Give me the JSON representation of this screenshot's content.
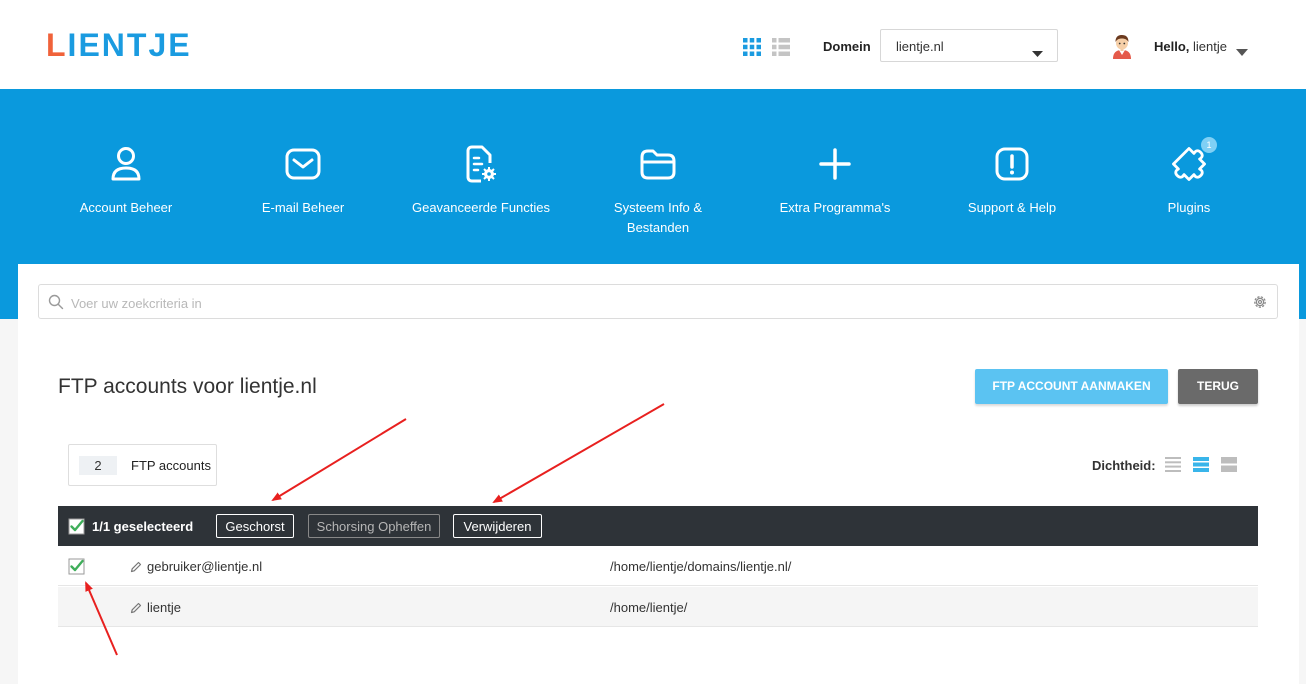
{
  "header": {
    "logo": {
      "first_letter": "L",
      "rest": "IENTJE"
    },
    "domain_label": "Domein",
    "domain_value": "lientje.nl",
    "greeting": "Hello,",
    "username": "lientje"
  },
  "nav": {
    "items": [
      {
        "label": "Account Beheer",
        "icon": "user-icon"
      },
      {
        "label": "E-mail Beheer",
        "icon": "mail-icon"
      },
      {
        "label": "Geavanceerde Functies",
        "icon": "document-gear-icon"
      },
      {
        "label": "Systeem Info & Bestanden",
        "icon": "folder-icon"
      },
      {
        "label": "Extra Programma's",
        "icon": "plus-icon"
      },
      {
        "label": "Support & Help",
        "icon": "exclamation-icon"
      },
      {
        "label": "Plugins",
        "icon": "puzzle-icon",
        "badge": "1"
      }
    ]
  },
  "search": {
    "placeholder": "Voer uw zoekcriteria in"
  },
  "page": {
    "title": "FTP accounts voor lientje.nl",
    "create_button": "FTP ACCOUNT AANMAKEN",
    "back_button": "TERUG",
    "count_value": "2",
    "count_label": "FTP accounts",
    "density_label": "Dichtheid:"
  },
  "selection_bar": {
    "selected_text": "1/1 geselecteerd",
    "suspend_button": "Geschorst",
    "unsuspend_button": "Schorsing Opheffen",
    "delete_button": "Verwijderen"
  },
  "table": {
    "rows": [
      {
        "name": "gebruiker@lientje.nl",
        "path": "/home/lientje/domains/lientje.nl/",
        "checked": true
      },
      {
        "name": "lientje",
        "path": "/home/lientje/",
        "checked": false
      }
    ]
  },
  "colors": {
    "brand_blue": "#0a99dd",
    "logo_orange": "#f0623a",
    "create_button": "#5bc3f2",
    "back_button": "#6a6a6a",
    "selection_bar": "#2e3338",
    "check_green": "#3fae5a",
    "annotation_arrow": "#e8201f"
  }
}
